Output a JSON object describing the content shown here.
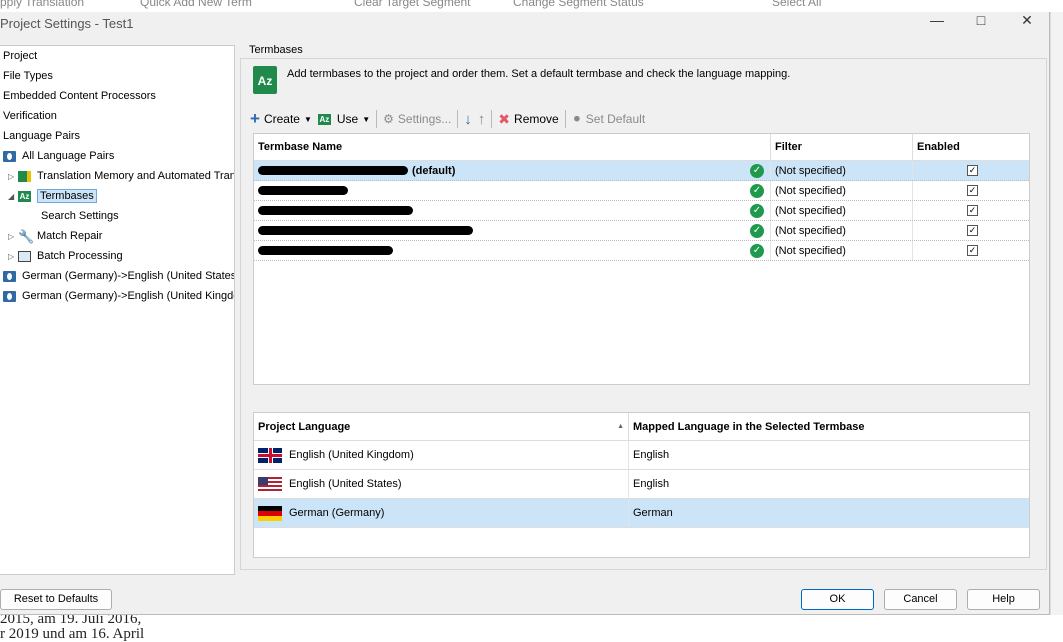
{
  "background": {
    "top_items": [
      "pply Translation",
      "Quick Add New Term",
      "Clear Target Segment",
      "Change Segment Status",
      "Select All"
    ],
    "bottom_text": [
      "2015, am 19. Juli 2016,",
      "r 2019 und am 16. April"
    ]
  },
  "window": {
    "title": "Project Settings - Test1"
  },
  "tree": {
    "items": [
      {
        "label": "Project"
      },
      {
        "label": "File Types"
      },
      {
        "label": "Embedded Content Processors"
      },
      {
        "label": "Verification"
      },
      {
        "label": "Language Pairs"
      },
      {
        "label": "All Language Pairs",
        "icon": "globe-icon"
      },
      {
        "label": "Translation Memory and Automated Translation",
        "icon": "tm-icon"
      },
      {
        "label": "Termbases",
        "icon": "termbase-icon",
        "selected": true
      },
      {
        "label": "Search Settings"
      },
      {
        "label": "Match Repair",
        "icon": "wrench-icon"
      },
      {
        "label": "Batch Processing",
        "icon": "batch-icon"
      },
      {
        "label": "German (Germany)->English (United States)",
        "icon": "globe-icon"
      },
      {
        "label": "German (Germany)->English (United Kingdom)",
        "icon": "globe-icon"
      }
    ]
  },
  "panel": {
    "group_label": "Termbases",
    "description": "Add termbases to the project and order them. Set a default termbase and check the language mapping."
  },
  "toolbar": {
    "create": "Create",
    "use": "Use",
    "settings": "Settings...",
    "remove": "Remove",
    "set_default": "Set Default"
  },
  "termbases": {
    "headers": [
      "Termbase Name",
      "Filter",
      "Enabled"
    ],
    "rows": [
      {
        "name_suffix": "(default)",
        "filter": "(Not specified)",
        "enabled": true,
        "selected": true
      },
      {
        "name_suffix": "",
        "filter": "(Not specified)",
        "enabled": true
      },
      {
        "name_suffix": "",
        "filter": "(Not specified)",
        "enabled": true
      },
      {
        "name_suffix": "",
        "filter": "(Not specified)",
        "enabled": true
      },
      {
        "name_suffix": "",
        "filter": "(Not specified)",
        "enabled": true
      }
    ]
  },
  "mapping": {
    "headers": [
      "Project Language",
      "Mapped Language in the Selected Termbase"
    ],
    "rows": [
      {
        "language": "English (United Kingdom)",
        "mapped": "English",
        "flag": "uk"
      },
      {
        "language": "English (United States)",
        "mapped": "English",
        "flag": "us"
      },
      {
        "language": "German (Germany)",
        "mapped": "German",
        "flag": "de",
        "selected": true
      }
    ]
  },
  "buttons": {
    "reset": "Reset to Defaults",
    "ok": "OK",
    "cancel": "Cancel",
    "help": "Help"
  },
  "colors": {
    "accent": "#0067c0",
    "selection": "#cce4f7",
    "termbase_green": "#1f8a4c"
  }
}
